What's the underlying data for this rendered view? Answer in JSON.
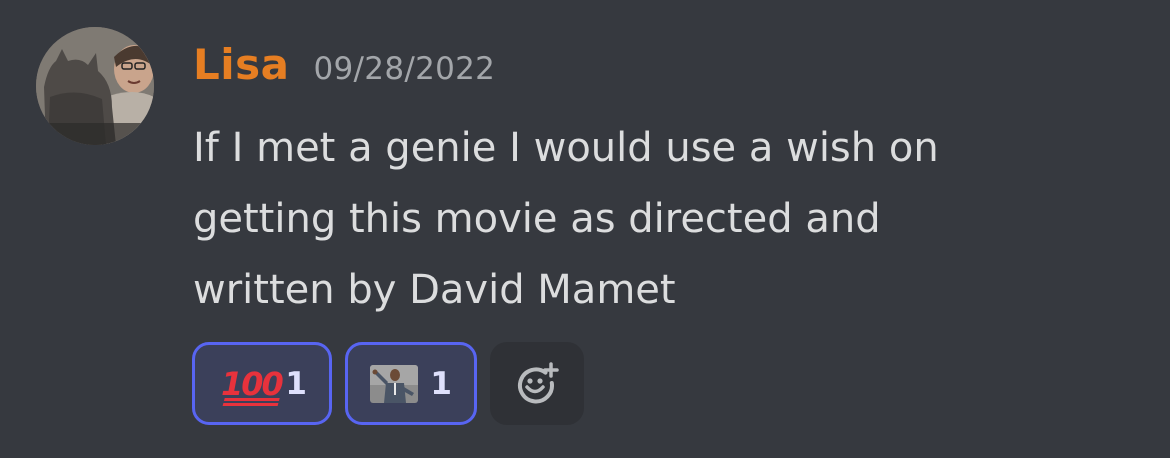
{
  "message": {
    "author": {
      "name": "Lisa",
      "name_color": "#e67e22",
      "avatar_icon": "avatar-person-with-cat"
    },
    "timestamp": "09/28/2022",
    "content_lines": [
      "If I met a genie I would use a wish on",
      "getting this movie as directed and",
      "written by David Mamet"
    ]
  },
  "reactions": [
    {
      "emoji_name": "hundred-points-icon",
      "count": "1",
      "selected": true
    },
    {
      "emoji_name": "custom-emoji-man-pointing-icon",
      "count": "1",
      "selected": true
    }
  ],
  "add_reaction": {
    "icon": "add-reaction-smiley-plus-icon"
  },
  "colors": {
    "background": "#36393f",
    "reaction_border": "#5865f2",
    "reaction_background": "#3b405a",
    "add_reaction_background": "#2f3136",
    "text": "#dcddde",
    "timestamp": "#a3a6aa"
  }
}
